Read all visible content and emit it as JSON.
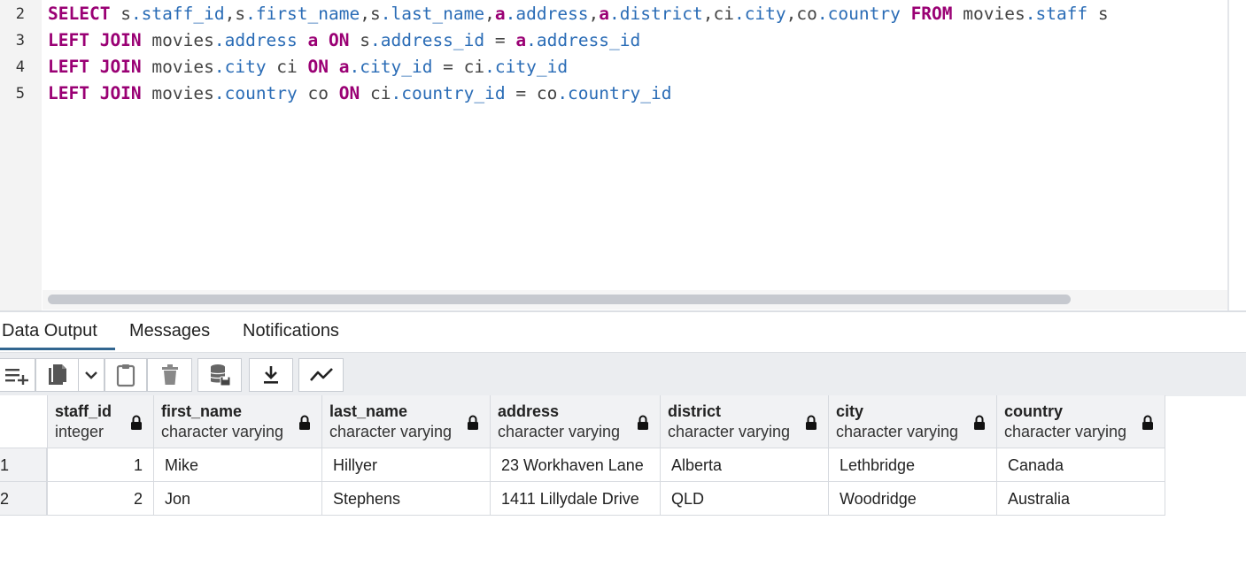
{
  "editor": {
    "line_numbers": [
      "2",
      "3",
      "4",
      "5"
    ],
    "lines": [
      [
        {
          "t": "SELECT",
          "c": "kw"
        },
        {
          "t": " s",
          "c": "op"
        },
        {
          "t": ".staff_id",
          "c": "fld"
        },
        {
          "t": ",s",
          "c": "op"
        },
        {
          "t": ".first_name",
          "c": "fld"
        },
        {
          "t": ",s",
          "c": "op"
        },
        {
          "t": ".last_name",
          "c": "fld"
        },
        {
          "t": ",",
          "c": "op"
        },
        {
          "t": "a",
          "c": "kw"
        },
        {
          "t": ".address",
          "c": "fld"
        },
        {
          "t": ",",
          "c": "op"
        },
        {
          "t": "a",
          "c": "kw"
        },
        {
          "t": ".district",
          "c": "fld"
        },
        {
          "t": ",ci",
          "c": "op"
        },
        {
          "t": ".city",
          "c": "fld"
        },
        {
          "t": ",co",
          "c": "op"
        },
        {
          "t": ".country",
          "c": "fld"
        },
        {
          "t": " ",
          "c": "op"
        },
        {
          "t": "FROM",
          "c": "kw"
        },
        {
          "t": " movies",
          "c": "op"
        },
        {
          "t": ".staff",
          "c": "fld"
        },
        {
          "t": " s",
          "c": "op"
        }
      ],
      [
        {
          "t": "LEFT JOIN",
          "c": "kw"
        },
        {
          "t": " movies",
          "c": "op"
        },
        {
          "t": ".address",
          "c": "fld"
        },
        {
          "t": " ",
          "c": "op"
        },
        {
          "t": "a",
          "c": "kw"
        },
        {
          "t": " ",
          "c": "op"
        },
        {
          "t": "ON",
          "c": "kw"
        },
        {
          "t": " s",
          "c": "op"
        },
        {
          "t": ".address_id",
          "c": "fld"
        },
        {
          "t": " = ",
          "c": "op"
        },
        {
          "t": "a",
          "c": "kw"
        },
        {
          "t": ".address_id",
          "c": "fld"
        }
      ],
      [
        {
          "t": "LEFT JOIN",
          "c": "kw"
        },
        {
          "t": " movies",
          "c": "op"
        },
        {
          "t": ".city",
          "c": "fld"
        },
        {
          "t": " ci ",
          "c": "op"
        },
        {
          "t": "ON",
          "c": "kw"
        },
        {
          "t": " ",
          "c": "op"
        },
        {
          "t": "a",
          "c": "kw"
        },
        {
          "t": ".city_id",
          "c": "fld"
        },
        {
          "t": " = ci",
          "c": "op"
        },
        {
          "t": ".city_id",
          "c": "fld"
        }
      ],
      [
        {
          "t": "LEFT JOIN",
          "c": "kw"
        },
        {
          "t": " movies",
          "c": "op"
        },
        {
          "t": ".country",
          "c": "fld"
        },
        {
          "t": " co ",
          "c": "op"
        },
        {
          "t": "ON",
          "c": "kw"
        },
        {
          "t": " ci",
          "c": "op"
        },
        {
          "t": ".country_id",
          "c": "fld"
        },
        {
          "t": " = co",
          "c": "op"
        },
        {
          "t": ".country_id",
          "c": "fld"
        }
      ]
    ]
  },
  "tabs": {
    "data_output": "Data Output",
    "messages": "Messages",
    "notifications": "Notifications",
    "active": "data_output"
  },
  "toolbar": {
    "icons": [
      "add-row-icon",
      "copy-icon",
      "chevron-down-icon",
      "paste-icon",
      "delete-icon",
      "save-data-icon",
      "download-icon",
      "graph-icon"
    ]
  },
  "grid": {
    "columns": [
      {
        "name": "staff_id",
        "type": "integer",
        "locked": true
      },
      {
        "name": "first_name",
        "type": "character varying",
        "locked": true
      },
      {
        "name": "last_name",
        "type": "character varying",
        "locked": true
      },
      {
        "name": "address",
        "type": "character varying",
        "locked": true
      },
      {
        "name": "district",
        "type": "character varying",
        "locked": true
      },
      {
        "name": "city",
        "type": "character varying",
        "locked": true
      },
      {
        "name": "country",
        "type": "character varying",
        "locked": true
      }
    ],
    "rows": [
      {
        "num": "1",
        "cells": [
          "1",
          "Mike",
          "Hillyer",
          "23 Workhaven Lane",
          "Alberta",
          "Lethbridge",
          "Canada"
        ]
      },
      {
        "num": "2",
        "cells": [
          "2",
          "Jon",
          "Stephens",
          "1411 Lillydale Drive",
          "QLD",
          "Woodridge",
          "Australia"
        ]
      }
    ]
  }
}
